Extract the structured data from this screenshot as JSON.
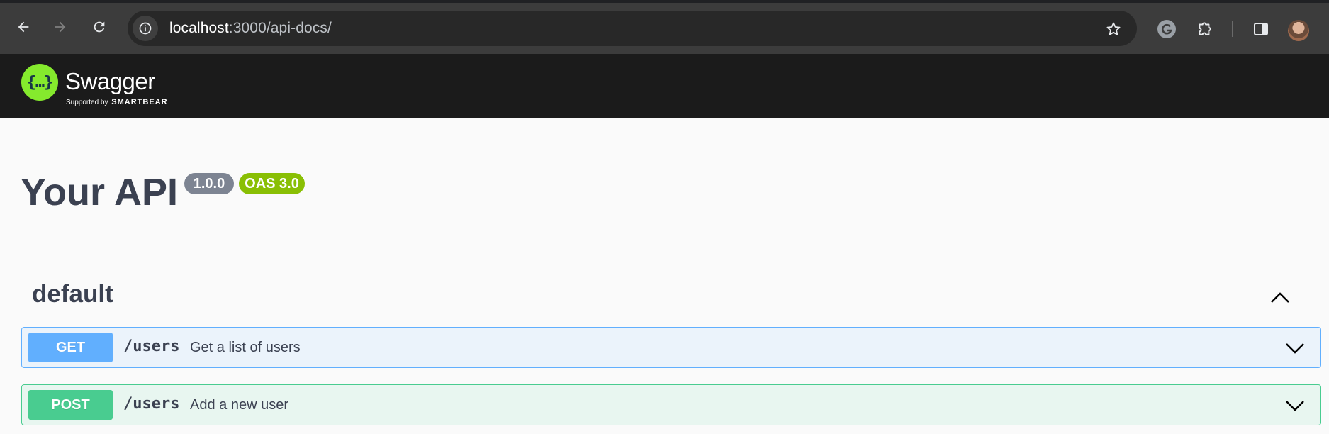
{
  "browser": {
    "url_host": "localhost",
    "url_path": ":3000/api-docs/",
    "icons": {
      "back": "arrow-left-icon",
      "forward": "arrow-right-icon",
      "reload": "reload-icon",
      "site_info": "info-icon",
      "bookmark": "star-icon",
      "grammarly": "grammarly-icon",
      "extensions": "puzzle-icon",
      "side_panel": "side-panel-icon",
      "profile": "avatar"
    }
  },
  "swagger_header": {
    "logo_glyph": "{…}",
    "wordmark": "Swagger",
    "tm": "™",
    "supported_by": "Supported by",
    "sponsor": "SMARTBEAR"
  },
  "info": {
    "title": "Your API",
    "version": "1.0.0",
    "oas_version": "OAS 3.0"
  },
  "tags": [
    {
      "name": "default",
      "expanded": true,
      "operations": [
        {
          "method": "GET",
          "path": "/users",
          "summary": "Get a list of users",
          "color": "#61affe"
        },
        {
          "method": "POST",
          "path": "/users",
          "summary": "Add a new user",
          "color": "#49cc90"
        }
      ]
    }
  ],
  "colors": {
    "chrome_toolbar": "#3c3c3c",
    "omnibox": "#282828",
    "swagger_topbar": "#1b1b1b",
    "swagger_logo": "#85ea2d",
    "title_text": "#3b4151",
    "version_badge": "#7d8492",
    "oas_badge": "#89bf04",
    "get": "#61affe",
    "post": "#49cc90"
  }
}
